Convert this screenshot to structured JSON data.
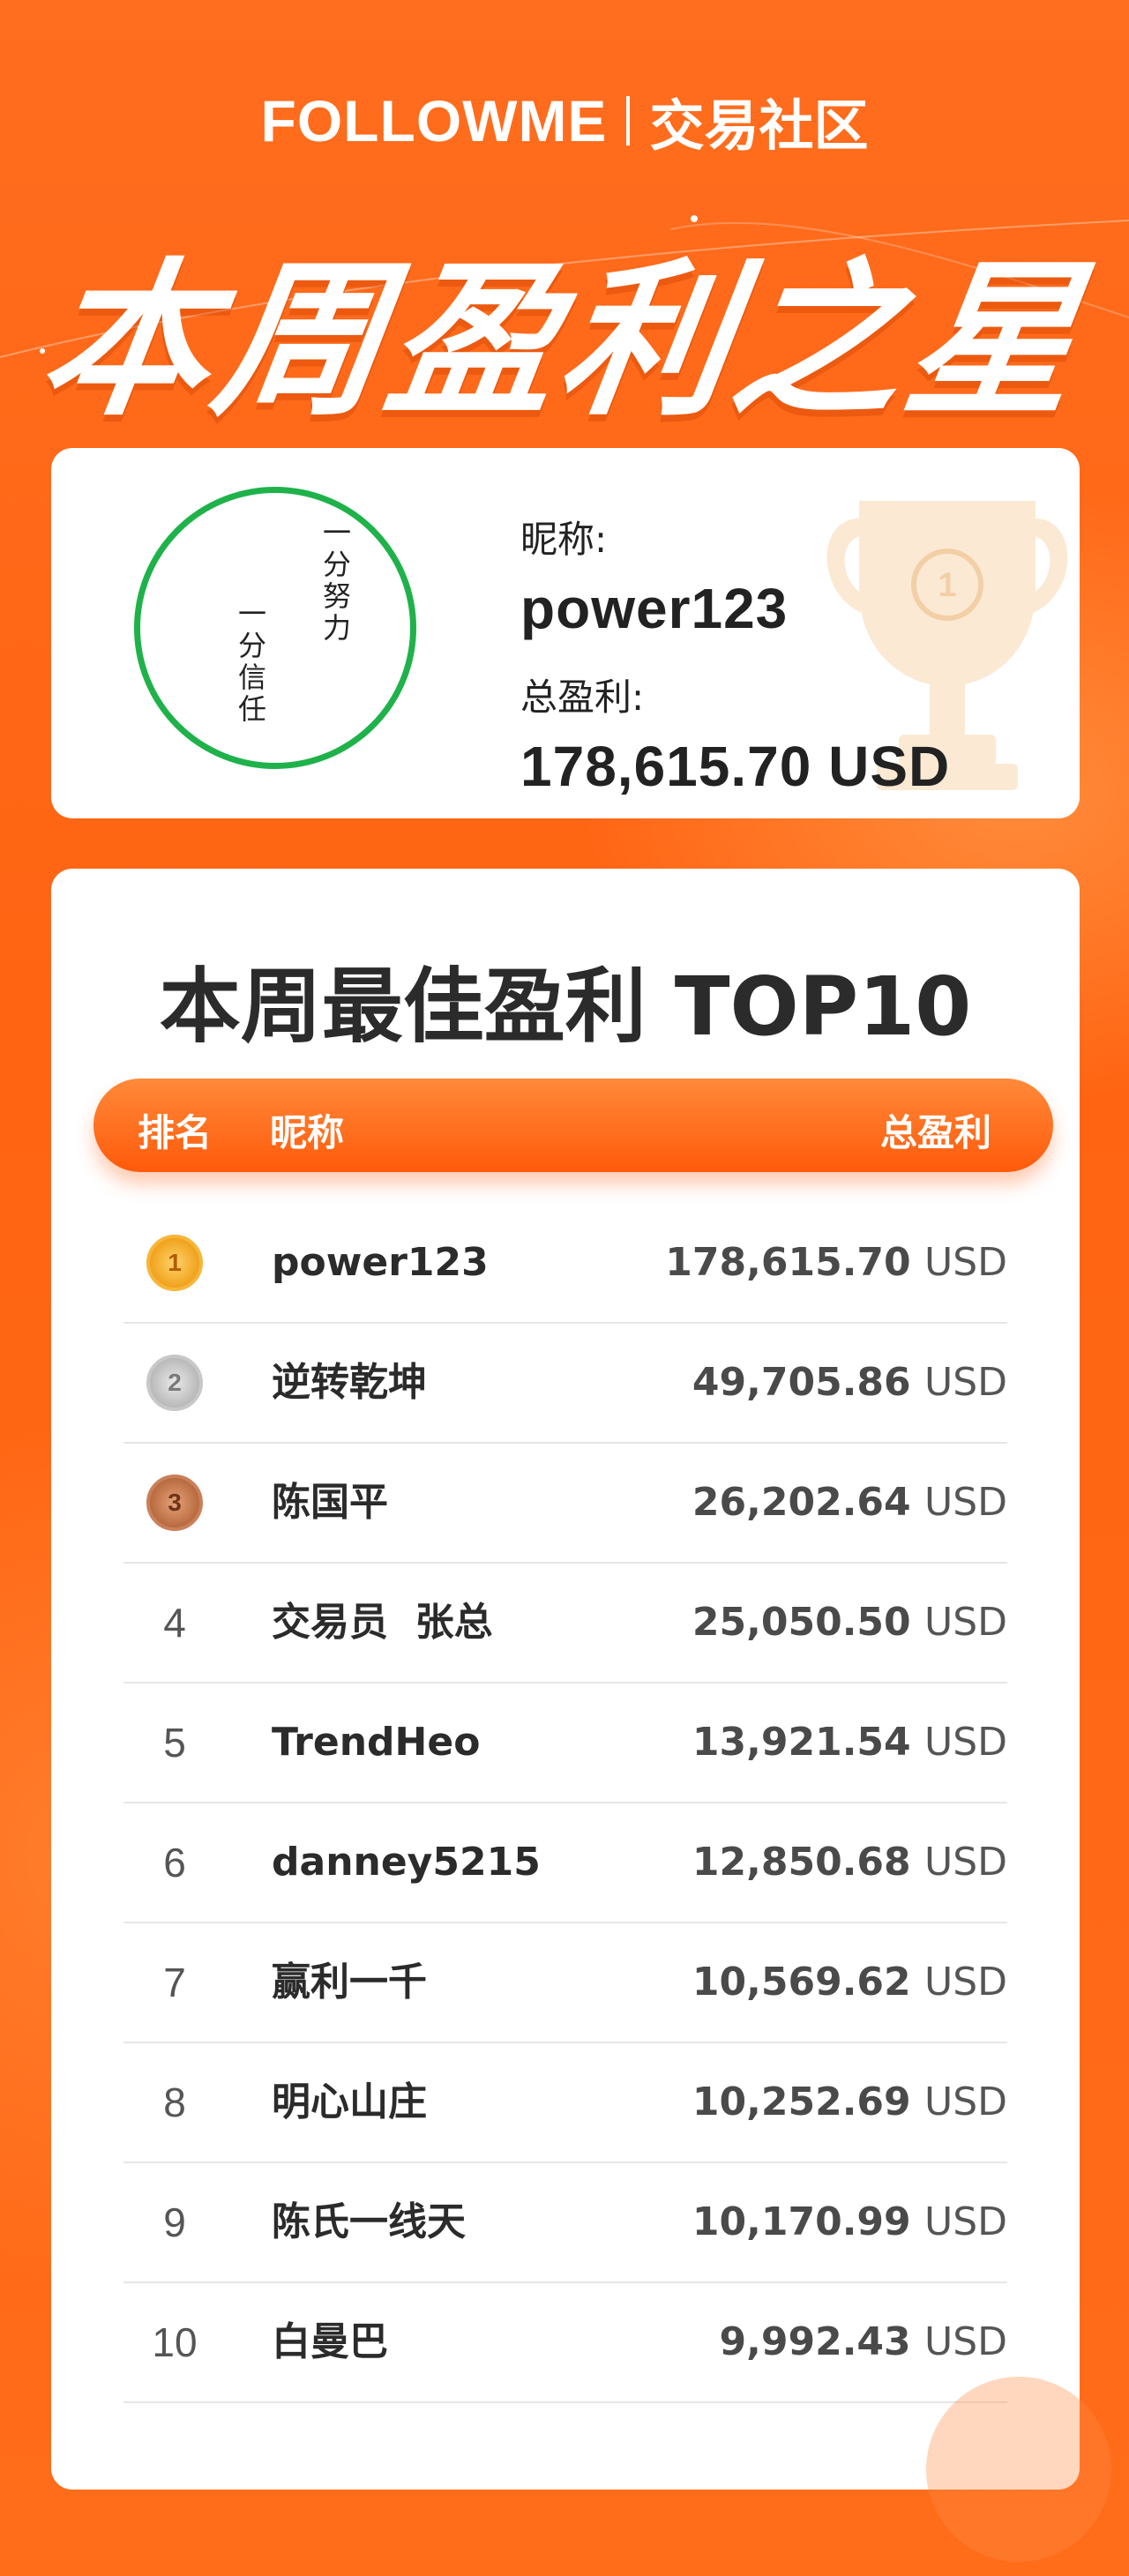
{
  "header": {
    "logo": "FOLLOWME",
    "community": "交易社区",
    "headline": "本周盈利之星"
  },
  "winner": {
    "avatar_text": [
      "一分努力",
      "一分信任"
    ],
    "nickname_label": "昵称:",
    "nickname": "power123",
    "profit_label": "总盈利:",
    "profit": "178,615.70 USD",
    "trophy_rank": "1"
  },
  "ranking": {
    "title": "本周最佳盈利 TOP10",
    "columns": {
      "rank": "排名",
      "name": "昵称",
      "profit": "总盈利"
    },
    "rows": [
      {
        "rank": "1",
        "medal": "gold-medal",
        "name": "power123",
        "profit": "178,615.70",
        "unit": "USD"
      },
      {
        "rank": "2",
        "medal": "silver-medal",
        "name": "逆转乾坤",
        "profit": "49,705.86",
        "unit": "USD"
      },
      {
        "rank": "3",
        "medal": "bronze-medal",
        "name": "陈国平",
        "profit": "26,202.64",
        "unit": "USD"
      },
      {
        "rank": "4",
        "name": "交易员  张总",
        "profit": "25,050.50",
        "unit": "USD"
      },
      {
        "rank": "5",
        "name": "TrendHeo",
        "profit": "13,921.54",
        "unit": "USD"
      },
      {
        "rank": "6",
        "name": "danney5215",
        "profit": "12,850.68",
        "unit": "USD"
      },
      {
        "rank": "7",
        "name": "赢利一千",
        "profit": "10,569.62",
        "unit": "USD"
      },
      {
        "rank": "8",
        "name": "明心山庄",
        "profit": "10,252.69",
        "unit": "USD"
      },
      {
        "rank": "9",
        "name": "陈氏一线天",
        "profit": "10,170.99",
        "unit": "USD"
      },
      {
        "rank": "10",
        "name": "白曼巴",
        "profit": "9,992.43",
        "unit": "USD"
      }
    ]
  },
  "colors": {
    "background": "#ff6a1a",
    "accent": "#ff5a0a",
    "avatar_ring": "#1fb24a",
    "text_dark": "#2b2b2b"
  }
}
